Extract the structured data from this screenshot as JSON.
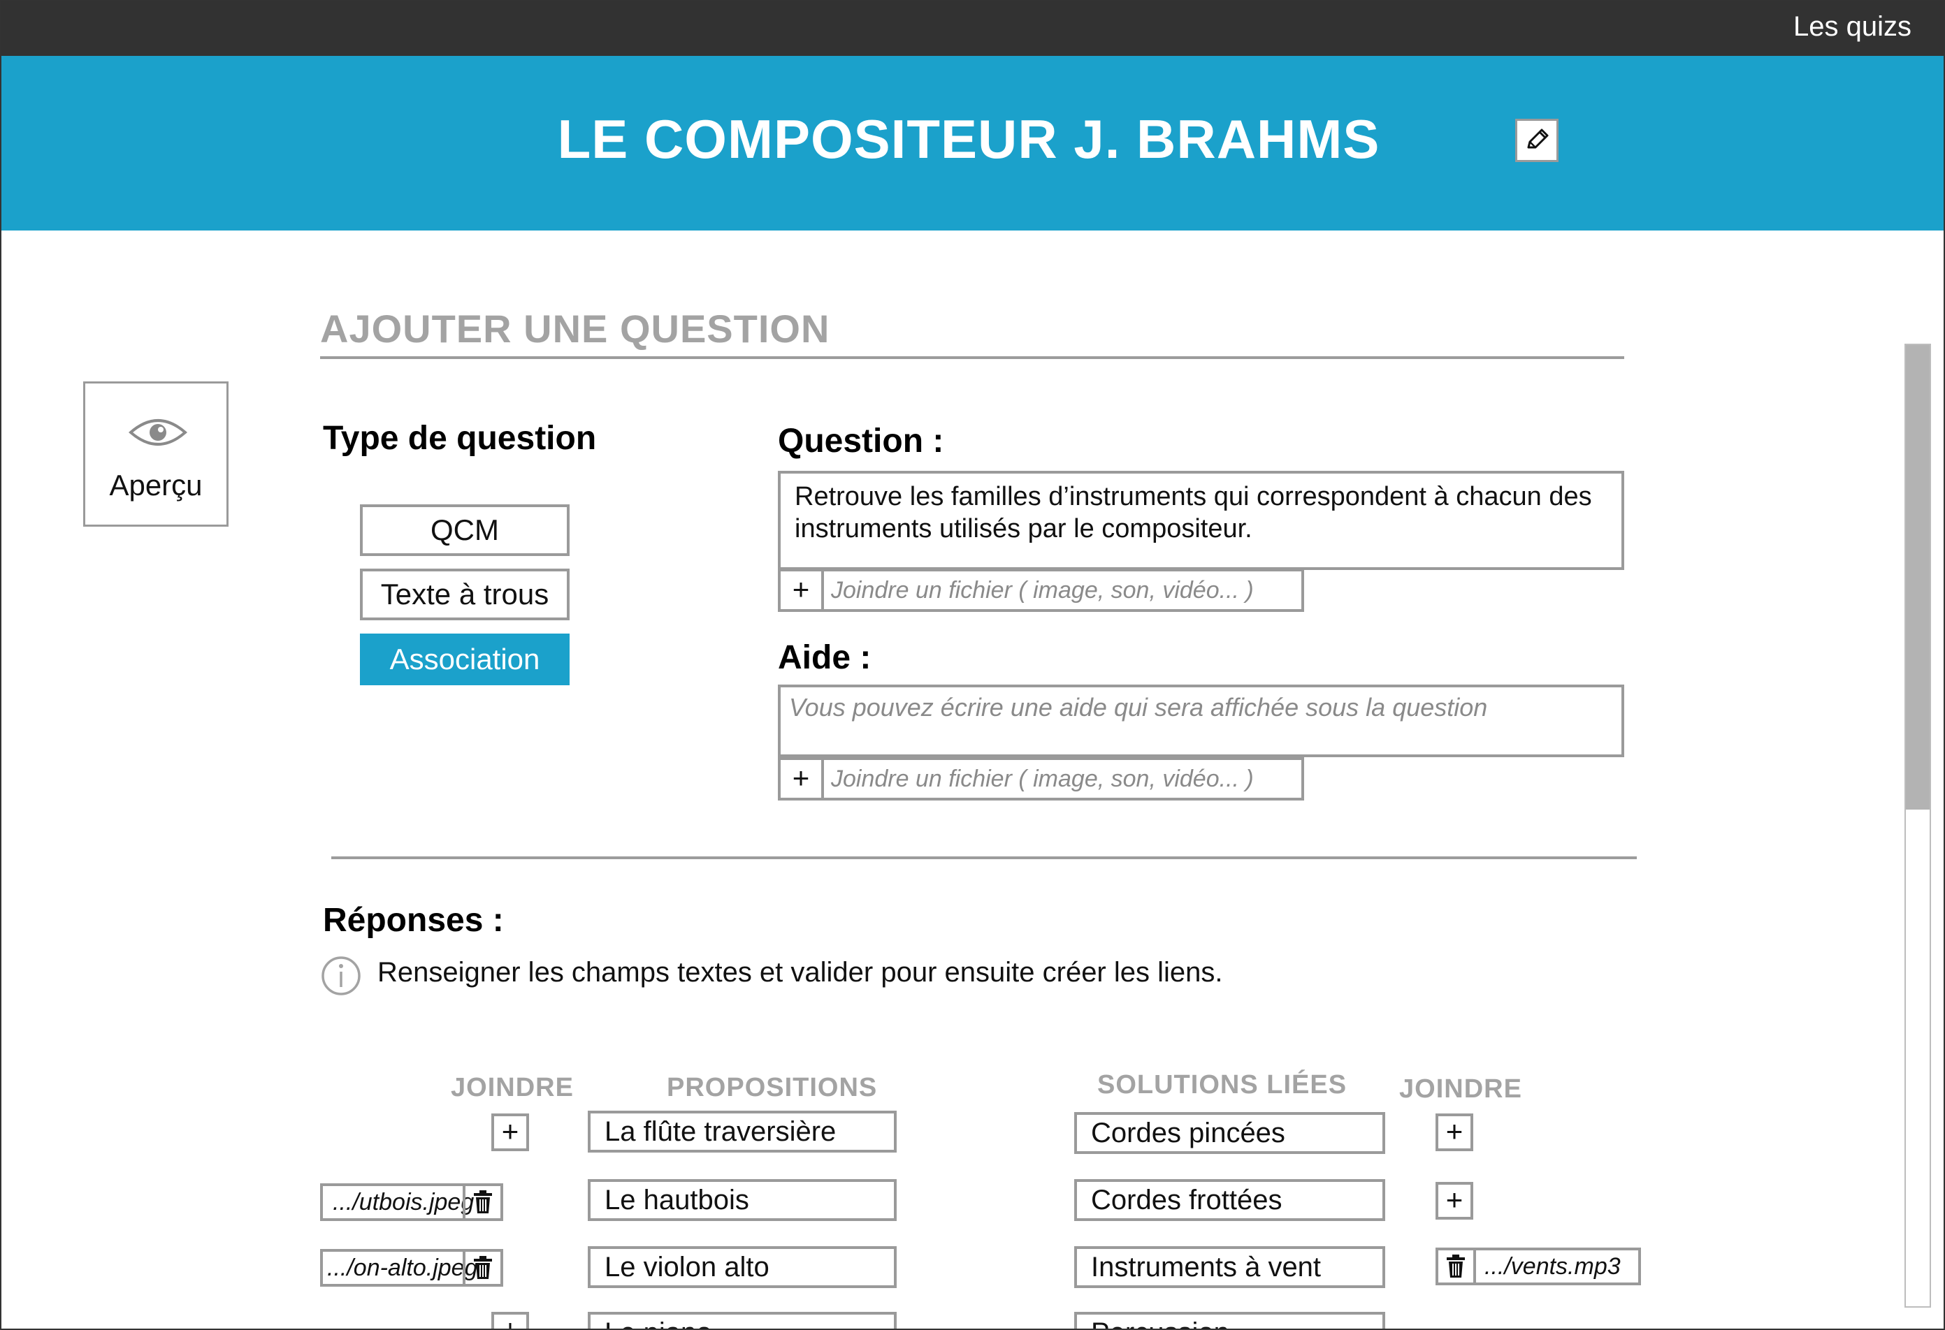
{
  "topbar": {
    "link_label": "Les quizs"
  },
  "header": {
    "title": "LE COMPOSITEUR J. BRAHMS",
    "edit_icon": "pencil-icon"
  },
  "section": {
    "title": "AJOUTER UNE QUESTION"
  },
  "preview": {
    "label": "Aperçu",
    "icon": "eye-icon"
  },
  "question_type": {
    "heading": "Type de question",
    "options": [
      "QCM",
      "Texte à trous",
      "Association"
    ],
    "selected": "Association"
  },
  "question": {
    "heading": "Question :",
    "value": "Retrouve les familles d’instruments qui correspondent à chacun des instruments utilisés par le compositeur.",
    "attach_placeholder": "Joindre un fichier ( image, son, vidéo... )"
  },
  "help": {
    "heading": "Aide :",
    "placeholder": "Vous pouvez écrire une aide qui sera affichée sous la question",
    "attach_placeholder": "Joindre un fichier ( image, son, vidéo... )"
  },
  "answers": {
    "heading": "Réponses :",
    "info": "Renseigner les champs textes et valider pour ensuite créer les liens.",
    "columns": {
      "join_left": "JOINDRE",
      "propositions": "PROPOSITIONS",
      "solutions": "SOLUTIONS LIÉES",
      "join_right": "JOINDRE"
    },
    "left_files": [
      "",
      ".../utbois.jpeg",
      ".../on-alto.jpeg",
      ""
    ],
    "propositions": [
      "La flûte traversière",
      "Le hautbois",
      "Le violon alto",
      "Le piano"
    ],
    "solutions": [
      "Cordes pincées",
      "Cordes frottées",
      "Instruments à vent",
      "Percussion"
    ],
    "right_files": [
      "",
      "",
      ".../vents.mp3",
      ""
    ]
  },
  "colors": {
    "accent": "#1ba1cb",
    "topbar": "#323232",
    "border": "#9a9a9a",
    "muted_heading": "#a3a3a3"
  }
}
